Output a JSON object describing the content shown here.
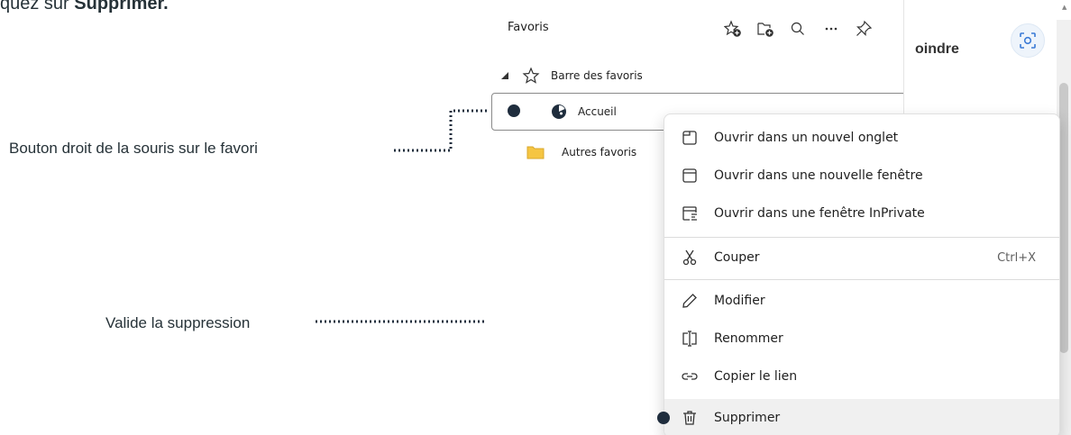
{
  "heading": {
    "prefix": "quez sur ",
    "bold": "Supprimer."
  },
  "callouts": {
    "right_click": "Bouton droit de la souris sur le favori",
    "validate": "Valide la suppression"
  },
  "panel": {
    "title": "Favoris",
    "toolbar_icons": [
      "add-favorite-icon",
      "add-folder-icon",
      "search-icon",
      "more-icon",
      "pin-icon"
    ],
    "tree": {
      "bar": "Barre des favoris",
      "accueil": "Accueil",
      "others": "Autres favoris"
    }
  },
  "browser": {
    "partial_text": "oindre"
  },
  "context_menu": {
    "items": [
      {
        "label": "Ouvrir dans un nouvel onglet",
        "icon": "new-tab-icon"
      },
      {
        "label": "Ouvrir dans une nouvelle fenêtre",
        "icon": "new-window-icon"
      },
      {
        "label": "Ouvrir dans une fenêtre InPrivate",
        "icon": "inprivate-window-icon"
      },
      {
        "label": "Couper",
        "icon": "scissors-icon",
        "shortcut": "Ctrl+X"
      },
      {
        "label": "Modifier",
        "icon": "pencil-icon"
      },
      {
        "label": "Renommer",
        "icon": "rename-icon"
      },
      {
        "label": "Copier le lien",
        "icon": "link-icon"
      },
      {
        "label": "Supprimer",
        "icon": "trash-icon"
      }
    ]
  },
  "colors": {
    "annotation": "#1f2d3d",
    "folder": "#f5c542"
  }
}
